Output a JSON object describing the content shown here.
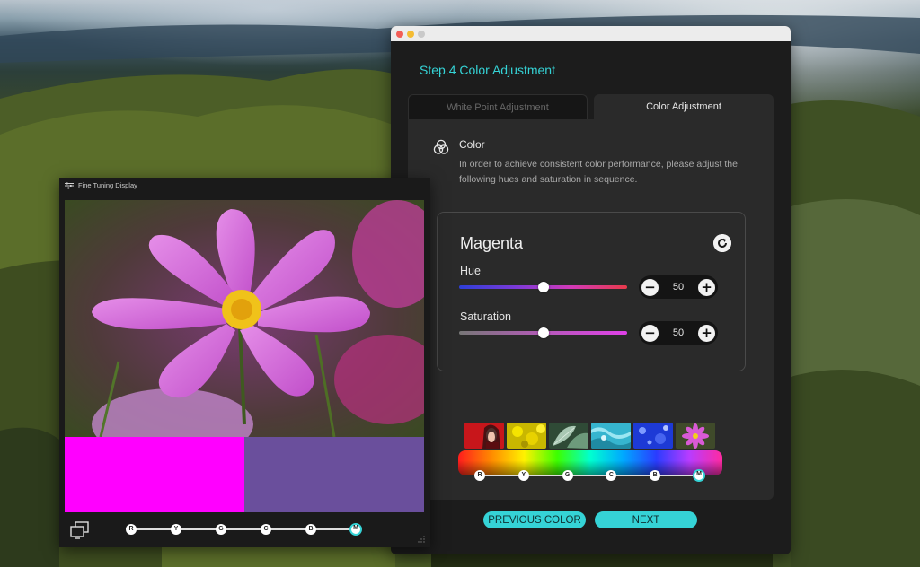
{
  "main_window": {
    "step_title": "Step.4 Color Adjustment",
    "tabs": [
      {
        "label": "White Point Adjustment",
        "active": false
      },
      {
        "label": "Color Adjustment",
        "active": true
      }
    ],
    "section": {
      "heading": "Color",
      "icon": "color-circles-icon",
      "description": "In order to achieve consistent color performance, please adjust the following hues and saturation in sequence."
    },
    "adjust_box": {
      "title": "Magenta",
      "reset_icon": "refresh-icon",
      "hue": {
        "label": "Hue",
        "value": "50",
        "fraction": 0.5
      },
      "saturation": {
        "label": "Saturation",
        "value": "50",
        "fraction": 0.5
      },
      "minus_label": "−",
      "plus_label": "+"
    },
    "sequence_nodes": [
      "R",
      "Y",
      "G",
      "C",
      "B",
      "M"
    ],
    "active_node": "M",
    "buttons": {
      "previous": "PREVIOUS COLOR",
      "next": "NEXT"
    }
  },
  "fine_tuning": {
    "title": "Fine Tuning Display",
    "icon": "sliders-icon",
    "swatch_colors": [
      "#ff00ff",
      "#6a4f9c"
    ],
    "nodes": [
      "R",
      "Y",
      "G",
      "C",
      "B",
      "M"
    ],
    "active_node": "M",
    "footer_icon": "display-compare-icon"
  },
  "colors": {
    "accent": "#35d3d6"
  }
}
